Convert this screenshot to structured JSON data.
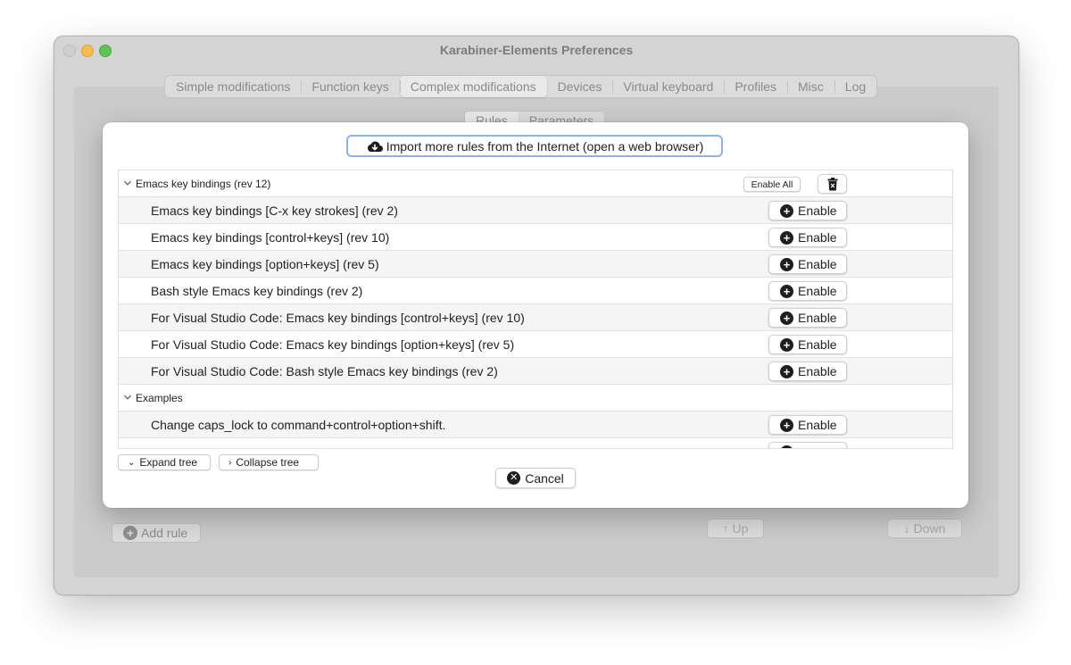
{
  "window": {
    "title": "Karabiner-Elements Preferences"
  },
  "tabs": [
    {
      "label": "Simple modifications"
    },
    {
      "label": "Function keys"
    },
    {
      "label": "Complex modifications"
    },
    {
      "label": "Devices"
    },
    {
      "label": "Virtual keyboard"
    },
    {
      "label": "Profiles"
    },
    {
      "label": "Misc"
    },
    {
      "label": "Log"
    }
  ],
  "active_tab": "Complex modifications",
  "subtabs": [
    {
      "label": "Rules"
    },
    {
      "label": "Parameters"
    }
  ],
  "background_buttons": {
    "add_rule": "Add rule",
    "up": "↑ Up",
    "down": "↓ Down"
  },
  "dialog": {
    "import_button": "Import more rules from the Internet (open a web browser)",
    "groups": [
      {
        "title": "Emacs key bindings (rev 12)",
        "enable_all": "Enable All",
        "rules": [
          {
            "label": "Emacs key bindings [C-x key strokes] (rev 2)",
            "button": "Enable"
          },
          {
            "label": "Emacs key bindings [control+keys] (rev 10)",
            "button": "Enable"
          },
          {
            "label": "Emacs key bindings [option+keys] (rev 5)",
            "button": "Enable"
          },
          {
            "label": "Bash style Emacs key bindings (rev 2)",
            "button": "Enable"
          },
          {
            "label": "For Visual Studio Code: Emacs key bindings [control+keys] (rev 10)",
            "button": "Enable"
          },
          {
            "label": "For Visual Studio Code: Emacs key bindings [option+keys] (rev 5)",
            "button": "Enable"
          },
          {
            "label": "For Visual Studio Code: Bash style Emacs key bindings (rev 2)",
            "button": "Enable"
          }
        ]
      },
      {
        "title": "Examples",
        "rules": [
          {
            "label": "Change caps_lock to command+control+option+shift.",
            "button": "Enable"
          }
        ]
      }
    ],
    "expand_tree": "Expand tree",
    "collapse_tree": "Collapse tree",
    "cancel": "Cancel"
  },
  "colors": {
    "focus_ring": "#8fb0ef",
    "traffic_min": "#f5bd4f",
    "traffic_max": "#5fc454"
  }
}
